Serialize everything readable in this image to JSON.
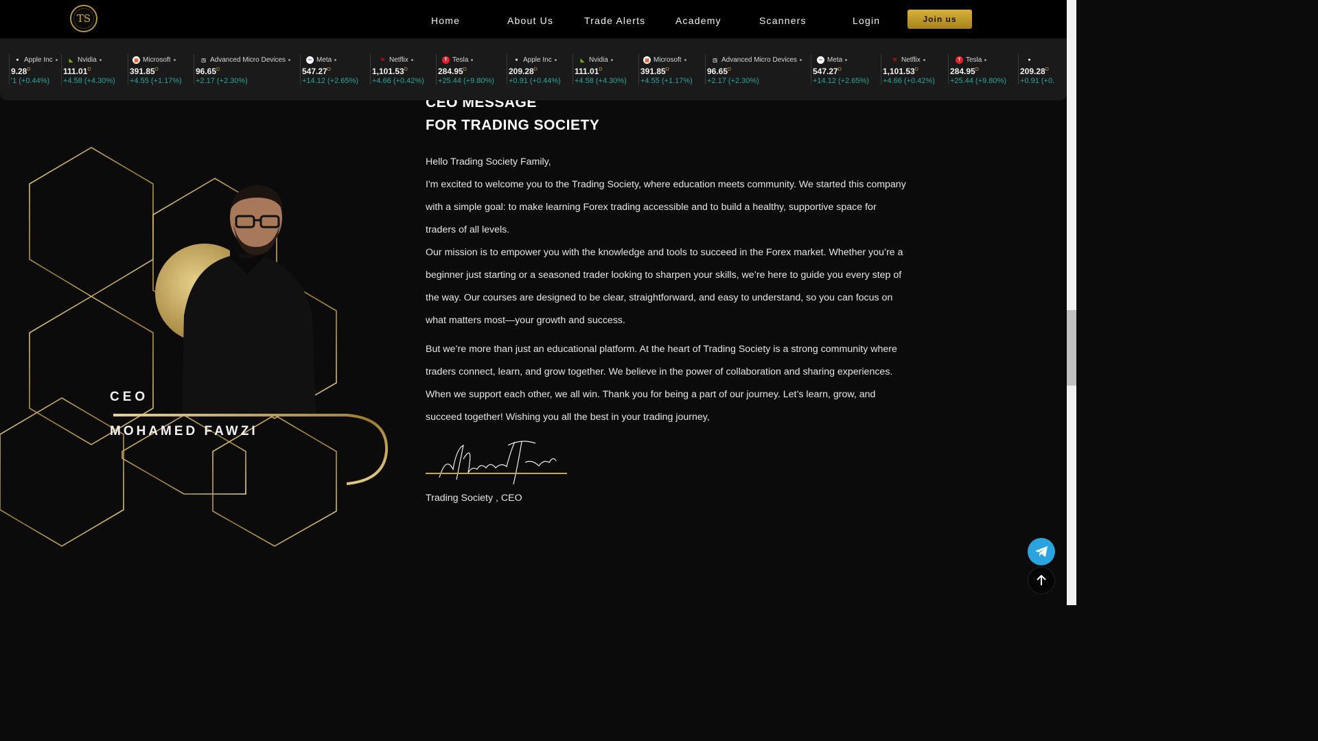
{
  "nav": {
    "logo_text": "TS",
    "items": [
      "Home",
      "About Us",
      "Trade Alerts",
      "Academy",
      "Scanners",
      "Login"
    ],
    "join_label": "Join us"
  },
  "ticker": [
    {
      "name": "Apple Inc",
      "price": "9.28",
      "change": "'1 (+0.44%)",
      "icon": "apple-icon",
      "color": "#ffffff"
    },
    {
      "name": "Nvidia",
      "price": "111.01",
      "change": "+4.58 (+4.30%)",
      "icon": "nvidia-icon",
      "color": "#76b900"
    },
    {
      "name": "Microsoft",
      "price": "391.85",
      "change": "+4.55 (+1.17%)",
      "icon": "microsoft-icon",
      "color": "#f25022"
    },
    {
      "name": "Advanced Micro Devices",
      "price": "96.65",
      "change": "+2.17 (+2.30%)",
      "icon": "amd-icon",
      "color": "#ffffff"
    },
    {
      "name": "Meta",
      "price": "547.27",
      "change": "+14.12 (+2.65%)",
      "icon": "meta-icon",
      "color": "#1877f2"
    },
    {
      "name": "Netflix",
      "price": "1,101.53",
      "change": "+4.66 (+0.42%)",
      "icon": "netflix-icon",
      "color": "#e50914"
    },
    {
      "name": "Tesla",
      "price": "284.95",
      "change": "+25.44 (+9.80%)",
      "icon": "tesla-icon",
      "color": "#e82127"
    },
    {
      "name": "Apple Inc",
      "price": "209.28",
      "change": "+0.91 (+0.44%)",
      "icon": "apple-icon",
      "color": "#ffffff"
    },
    {
      "name": "Nvidia",
      "price": "111.01",
      "change": "+4.58 (+4.30%)",
      "icon": "nvidia-icon",
      "color": "#76b900"
    },
    {
      "name": "Microsoft",
      "price": "391.85",
      "change": "+4.55 (+1.17%)",
      "icon": "microsoft-icon",
      "color": "#f25022"
    },
    {
      "name": "Advanced Micro Devices",
      "price": "96.65",
      "change": "+2.17 (+2.30%)",
      "icon": "amd-icon",
      "color": "#ffffff"
    },
    {
      "name": "Meta",
      "price": "547.27",
      "change": "+14.12 (+2.65%)",
      "icon": "meta-icon",
      "color": "#1877f2"
    },
    {
      "name": "Netflix",
      "price": "1,101.53",
      "change": "+4.66 (+0.42%)",
      "icon": "netflix-icon",
      "color": "#e50914"
    },
    {
      "name": "Tesla",
      "price": "284.95",
      "change": "+25.44 (+9.80%)",
      "icon": "tesla-icon",
      "color": "#e82127"
    },
    {
      "name": "",
      "price": "209.28",
      "change": "+0.91 (+0.",
      "icon": "apple-icon",
      "color": "#ffffff"
    }
  ],
  "ticker_currency_mark": "D",
  "left": {
    "role": "CEO",
    "name": "MOHAMED FAWZI"
  },
  "heading": {
    "line1": "CEO MESSAGE",
    "line2": "FOR TRADING SOCIETY"
  },
  "paragraphs": [
    "Hello Trading Society Family,",
    "I'm excited to welcome you to the Trading Society, where education meets community. We started this company with a simple goal: to make learning Forex trading accessible and to build a healthy, supportive space for traders of all levels.",
    "Our mission is to empower you with the knowledge and tools to succeed in the Forex market. Whether you’re a beginner just starting or a seasoned trader looking to sharpen your skills, we’re here to guide you every step of the way. Our courses are designed to be clear, straightforward, and easy to understand, so you can focus on what matters most—your growth and success.",
    "But we’re more than just an educational platform. At the heart of Trading Society is a strong community where traders connect, learn, and grow together. We believe in the power of collaboration and sharing experiences. When we support each other, we all win. Thank you for being a part of our journey. Let’s learn, grow, and succeed together! Wishing you all the best in your trading journey,"
  ],
  "signature_text": "Mohamed Fawzi",
  "signature_caption": "Trading Society , CEO",
  "colors": {
    "gold": "#c9a84c",
    "background": "#0b0b0b",
    "positive": "#26a69a",
    "telegram": "#2aa3df"
  }
}
